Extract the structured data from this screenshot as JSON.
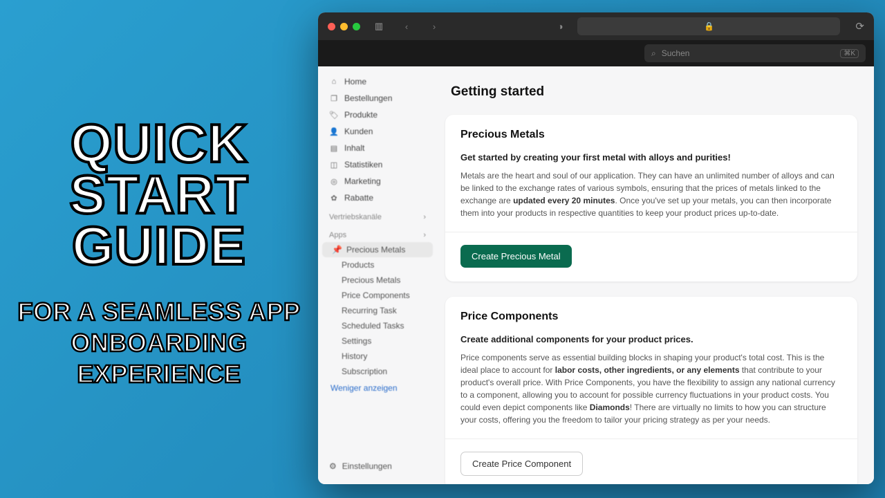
{
  "promo": {
    "title": "QUICK START GUIDE",
    "subtitle": "FOR A SEAMLESS APP ONBOARDING EXPERIENCE"
  },
  "browser": {
    "lock_icon": "🔒",
    "search_placeholder": "Suchen",
    "search_shortcut": "⌘K"
  },
  "sidebar": {
    "items": [
      {
        "icon": "⌂",
        "label": "Home"
      },
      {
        "icon": "❐",
        "label": "Bestellungen"
      },
      {
        "icon": "🏷",
        "label": "Produkte"
      },
      {
        "icon": "👤",
        "label": "Kunden"
      },
      {
        "icon": "▤",
        "label": "Inhalt"
      },
      {
        "icon": "◫",
        "label": "Statistiken"
      },
      {
        "icon": "◎",
        "label": "Marketing"
      },
      {
        "icon": "✿",
        "label": "Rabatte"
      }
    ],
    "section_channels": "Vertriebskanäle",
    "section_apps": "Apps",
    "app_items": [
      "Precious Metals",
      "Products",
      "Precious Metals",
      "Price Components",
      "Recurring Task",
      "Scheduled Tasks",
      "Settings",
      "History",
      "Subscription"
    ],
    "show_less": "Weniger anzeigen",
    "settings": "Einstellungen"
  },
  "page": {
    "title": "Getting started",
    "cards": [
      {
        "heading": "Precious Metals",
        "lead": "Get started by creating your first metal with alloys and purities!",
        "body_pre": "Metals are the heart and soul of our application. They can have an unlimited number of alloys and can be linked to the exchange rates of various symbols, ensuring that the prices of metals linked to the exchange are ",
        "body_bold": "updated every 20 minutes",
        "body_post": ". Once you've set up your metals, you can then incorporate them into your products in respective quantities to keep your product prices up-to-date.",
        "button": "Create Precious Metal",
        "button_style": "primary"
      },
      {
        "heading": "Price Components",
        "lead": "Create additional components for your product prices.",
        "body_pre": "Price components serve as essential building blocks in shaping your product's total cost. This is the ideal place to account for ",
        "body_bold": "labor costs, other ingredients, or any elements",
        "body_mid": " that contribute to your product's overall price. With Price Components, you have the flexibility to assign any national currency to a component, allowing you to account for possible currency fluctuations in your product costs. You could even depict components like ",
        "body_bold2": "Diamonds",
        "body_post": "! There are virtually no limits to how you can structure your costs, offering you the freedom to tailor your pricing strategy as per your needs.",
        "button": "Create Price Component",
        "button_style": "secondary"
      }
    ]
  }
}
